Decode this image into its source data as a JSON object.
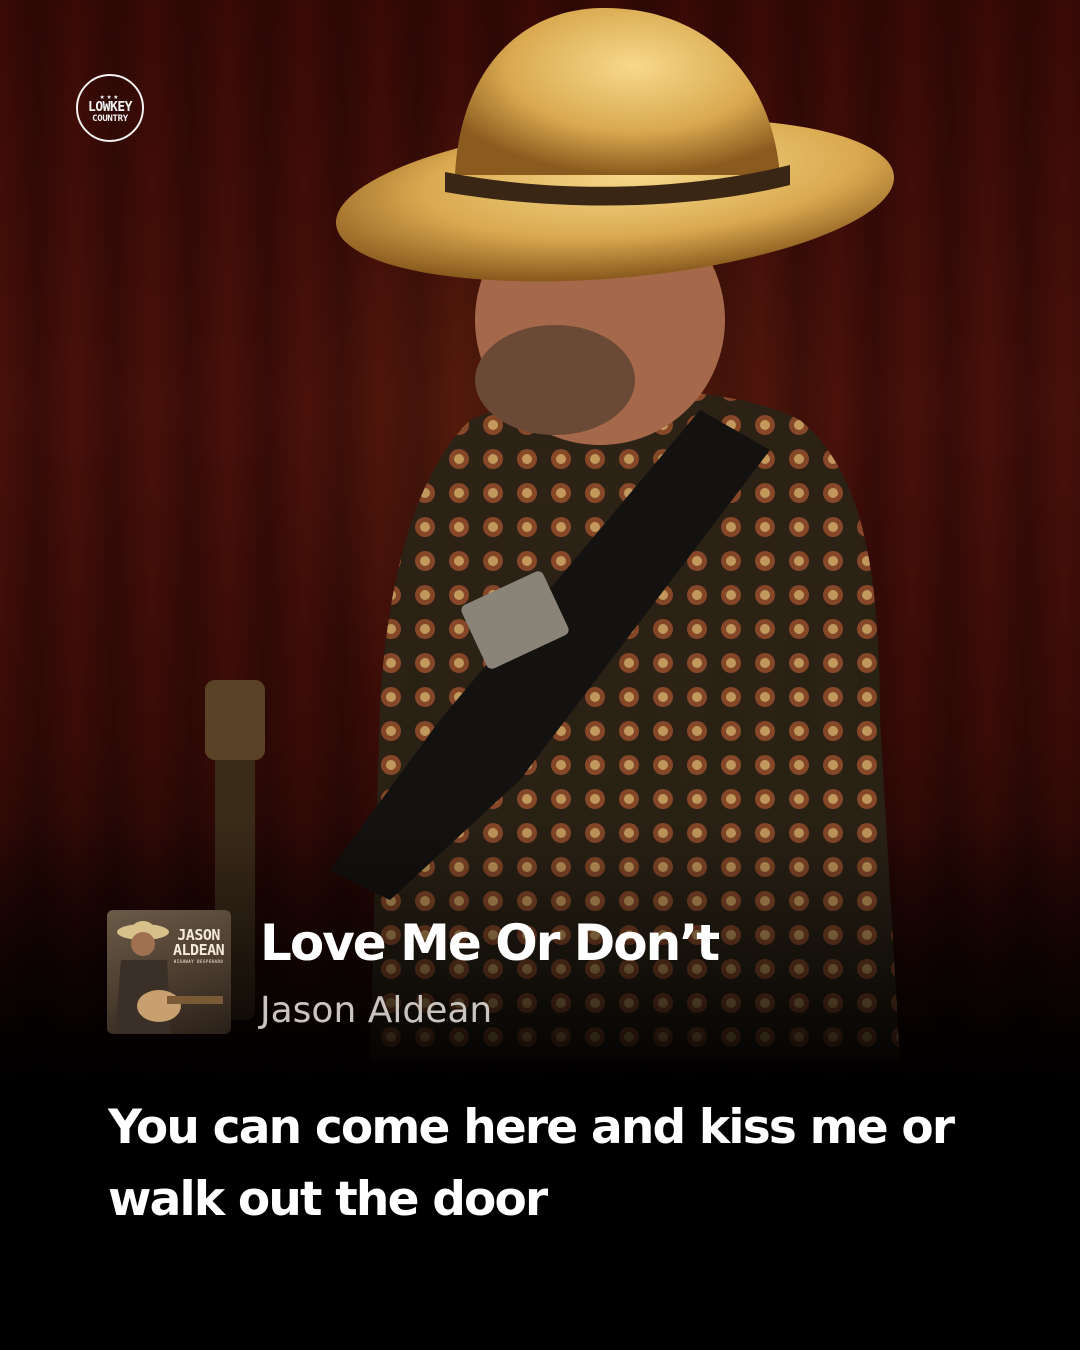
{
  "logo": {
    "stars": "★★★",
    "line1": "LOWKEY",
    "line2": "COUNTRY",
    "icon": "lowkey-country-logo-icon"
  },
  "album_cover": {
    "line1": "JASON",
    "line2": "ALDEAN",
    "sub": "HIGHWAY DESPERADO",
    "icon": "album-art-icon"
  },
  "song": {
    "title": "Love Me Or Don’t",
    "artist": "Jason Aldean"
  },
  "lyric": "You can come here and kiss me or walk out the door",
  "colors": {
    "background": "#000000",
    "curtain": "#4a100a",
    "title": "#ffffff",
    "artist": "#c9c4c0",
    "hat": "#e6c070"
  }
}
